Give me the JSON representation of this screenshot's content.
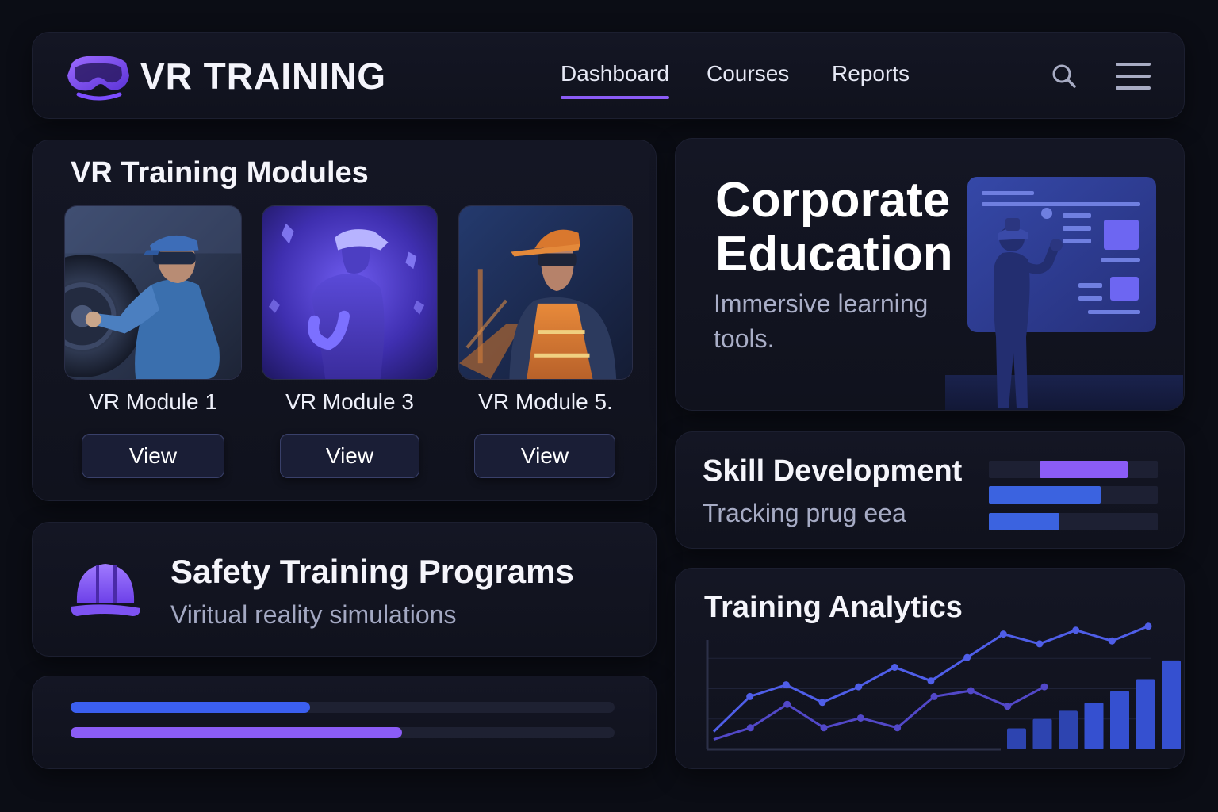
{
  "app": {
    "brand": "VR TRAINING",
    "logo_icon": "vr-headset-icon",
    "accent": "#8b5cf6",
    "accent_blue": "#3b5ff0"
  },
  "nav": {
    "items": [
      {
        "label": "Dashboard",
        "active": true
      },
      {
        "label": "Courses",
        "active": false
      },
      {
        "label": "Reports",
        "active": false
      }
    ],
    "search_icon": "search-icon",
    "menu_icon": "hamburger-menu-icon"
  },
  "modules": {
    "title": "VR Training Modules",
    "items": [
      {
        "label": "VR Module 1",
        "button": "View",
        "image": "mechanic-with-vr-headset"
      },
      {
        "label": "VR Module 3",
        "button": "View",
        "image": "figure-with-vr-headset"
      },
      {
        "label": "VR Module 5.",
        "button": "View",
        "image": "construction-worker-safety-vest"
      }
    ]
  },
  "corporate": {
    "title_line1": "Corporate",
    "title_line2": "Education",
    "subtitle": "Immersive learning tools."
  },
  "skill": {
    "title": "Skill Development",
    "subtitle": "Tracking prug eea",
    "bars": [
      {
        "start": 0.3,
        "end": 0.82,
        "color": "#8b5cf6"
      },
      {
        "start": 0.0,
        "end": 0.66,
        "color": "#3b63e0"
      },
      {
        "start": 0.0,
        "end": 0.42,
        "color": "#3b63e0"
      }
    ]
  },
  "safety": {
    "title": "Safety Training Programs",
    "subtitle": "Viritual reality simulations",
    "icon": "hard-hat-icon"
  },
  "progress": {
    "bars": [
      {
        "value": 0.44,
        "color": "#3b5ff0"
      },
      {
        "value": 0.61,
        "color": "#8b5cf6"
      }
    ]
  },
  "analytics": {
    "title": "Training Analytics"
  },
  "chart_data": {
    "type": "line",
    "title": "Training Analytics",
    "x": [
      1,
      2,
      3,
      4,
      5,
      6,
      7,
      8,
      9,
      10,
      11,
      12,
      13
    ],
    "series": [
      {
        "values": [
          10,
          46,
          58,
          40,
          56,
          76,
          62,
          86,
          110,
          100,
          114,
          103,
          118
        ]
      },
      {
        "values": [
          2,
          14,
          38,
          14,
          24,
          14,
          46,
          52,
          36,
          56
        ]
      }
    ],
    "bars": [
      18,
      26,
      33,
      40,
      50,
      60,
      76
    ],
    "grid": true
  }
}
